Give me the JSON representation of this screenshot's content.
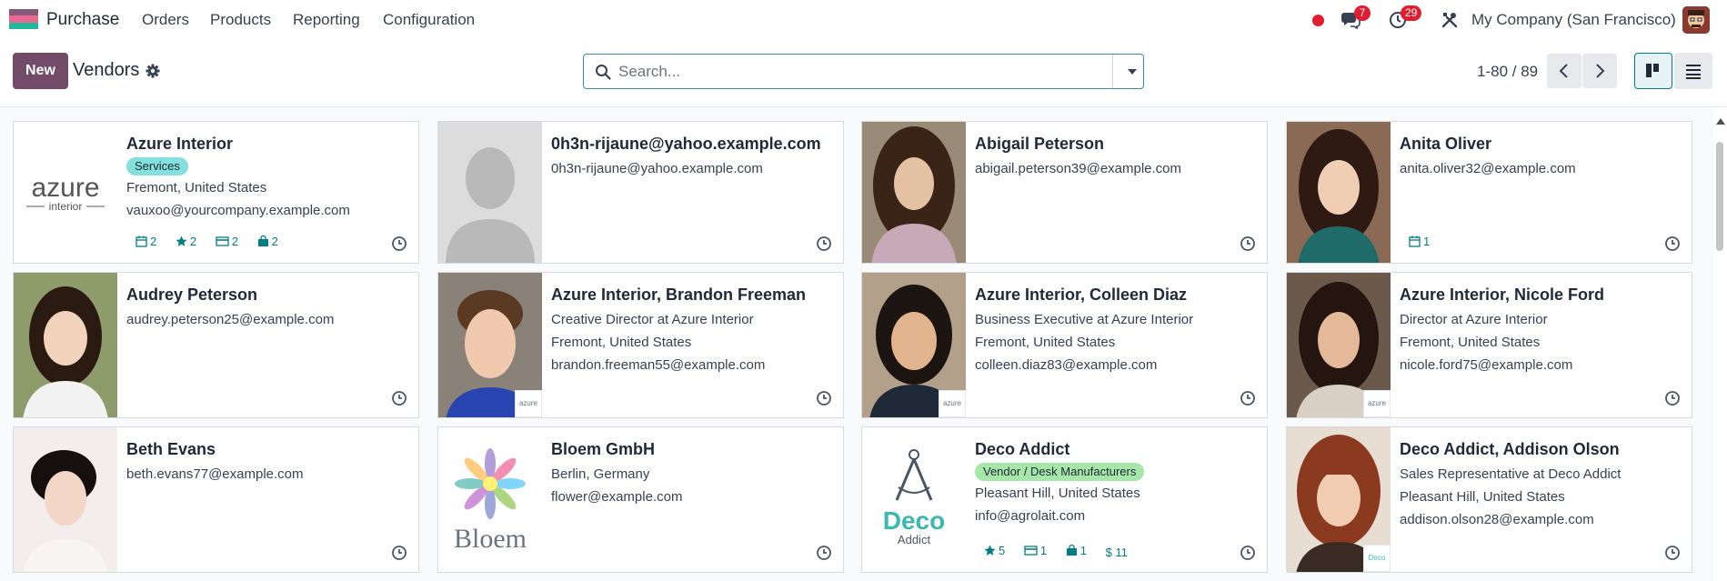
{
  "navbar": {
    "app_name": "Purchase",
    "menu": [
      "Orders",
      "Products",
      "Reporting",
      "Configuration"
    ],
    "messages_count": "7",
    "activities_count": "29",
    "company": "My Company (San Francisco)"
  },
  "control": {
    "new_label": "New",
    "breadcrumb": "Vendors",
    "search_placeholder": "Search...",
    "pager": "1-80 / 89"
  },
  "colors": {
    "brand": "#714b67",
    "accent": "#017e84",
    "tag_services": "#84e0dd",
    "tag_vendor": "#a6e7a9",
    "badge": "#e11d31"
  },
  "cards": [
    {
      "name": "Azure Interior",
      "tag": "Services",
      "lines": [
        "Fremont, United States",
        "vauxoo@yourcompany.example.com"
      ],
      "stats": {
        "meetings": "2",
        "favorites": "2",
        "bills": "2",
        "purchases": "2"
      },
      "logo_text": [
        "azure",
        "interior"
      ]
    },
    {
      "name": "0h3n-rijaune@yahoo.example.com",
      "lines": [
        "0h3n-rijaune@yahoo.example.com"
      ]
    },
    {
      "name": "Abigail Peterson",
      "lines": [
        "abigail.peterson39@example.com"
      ]
    },
    {
      "name": "Anita Oliver",
      "lines": [
        "anita.oliver32@example.com"
      ],
      "stats": {
        "meetings": "1"
      }
    },
    {
      "name": "Audrey Peterson",
      "lines": [
        "audrey.peterson25@example.com"
      ]
    },
    {
      "name": "Azure Interior, Brandon Freeman",
      "lines": [
        "Creative Director at Azure Interior",
        "Fremont, United States",
        "brandon.freeman55@example.com"
      ],
      "mini_logo": "azure"
    },
    {
      "name": "Azure Interior, Colleen Diaz",
      "lines": [
        "Business Executive at Azure Interior",
        "Fremont, United States",
        "colleen.diaz83@example.com"
      ],
      "mini_logo": "azure"
    },
    {
      "name": "Azure Interior, Nicole Ford",
      "lines": [
        "Director at Azure Interior",
        "Fremont, United States",
        "nicole.ford75@example.com"
      ],
      "mini_logo": "azure"
    },
    {
      "name": "Beth Evans",
      "lines": [
        "beth.evans77@example.com"
      ]
    },
    {
      "name": "Bloem GmbH",
      "lines": [
        "Berlin, Germany",
        "flower@example.com"
      ],
      "logo_text": [
        "Bloem"
      ]
    },
    {
      "name": "Deco Addict",
      "tag": "Vendor / Desk Manufacturers",
      "lines": [
        "Pleasant Hill, United States",
        "info@agrolait.com"
      ],
      "stats": {
        "favorites": "5",
        "bills": "1",
        "purchases": "1",
        "amount": "$ 11"
      },
      "logo_text": [
        "Deco",
        "Addict"
      ]
    },
    {
      "name": "Deco Addict, Addison Olson",
      "lines": [
        "Sales Representative at Deco Addict",
        "Pleasant Hill, United States",
        "addison.olson28@example.com"
      ],
      "mini_logo": "Deco"
    }
  ]
}
